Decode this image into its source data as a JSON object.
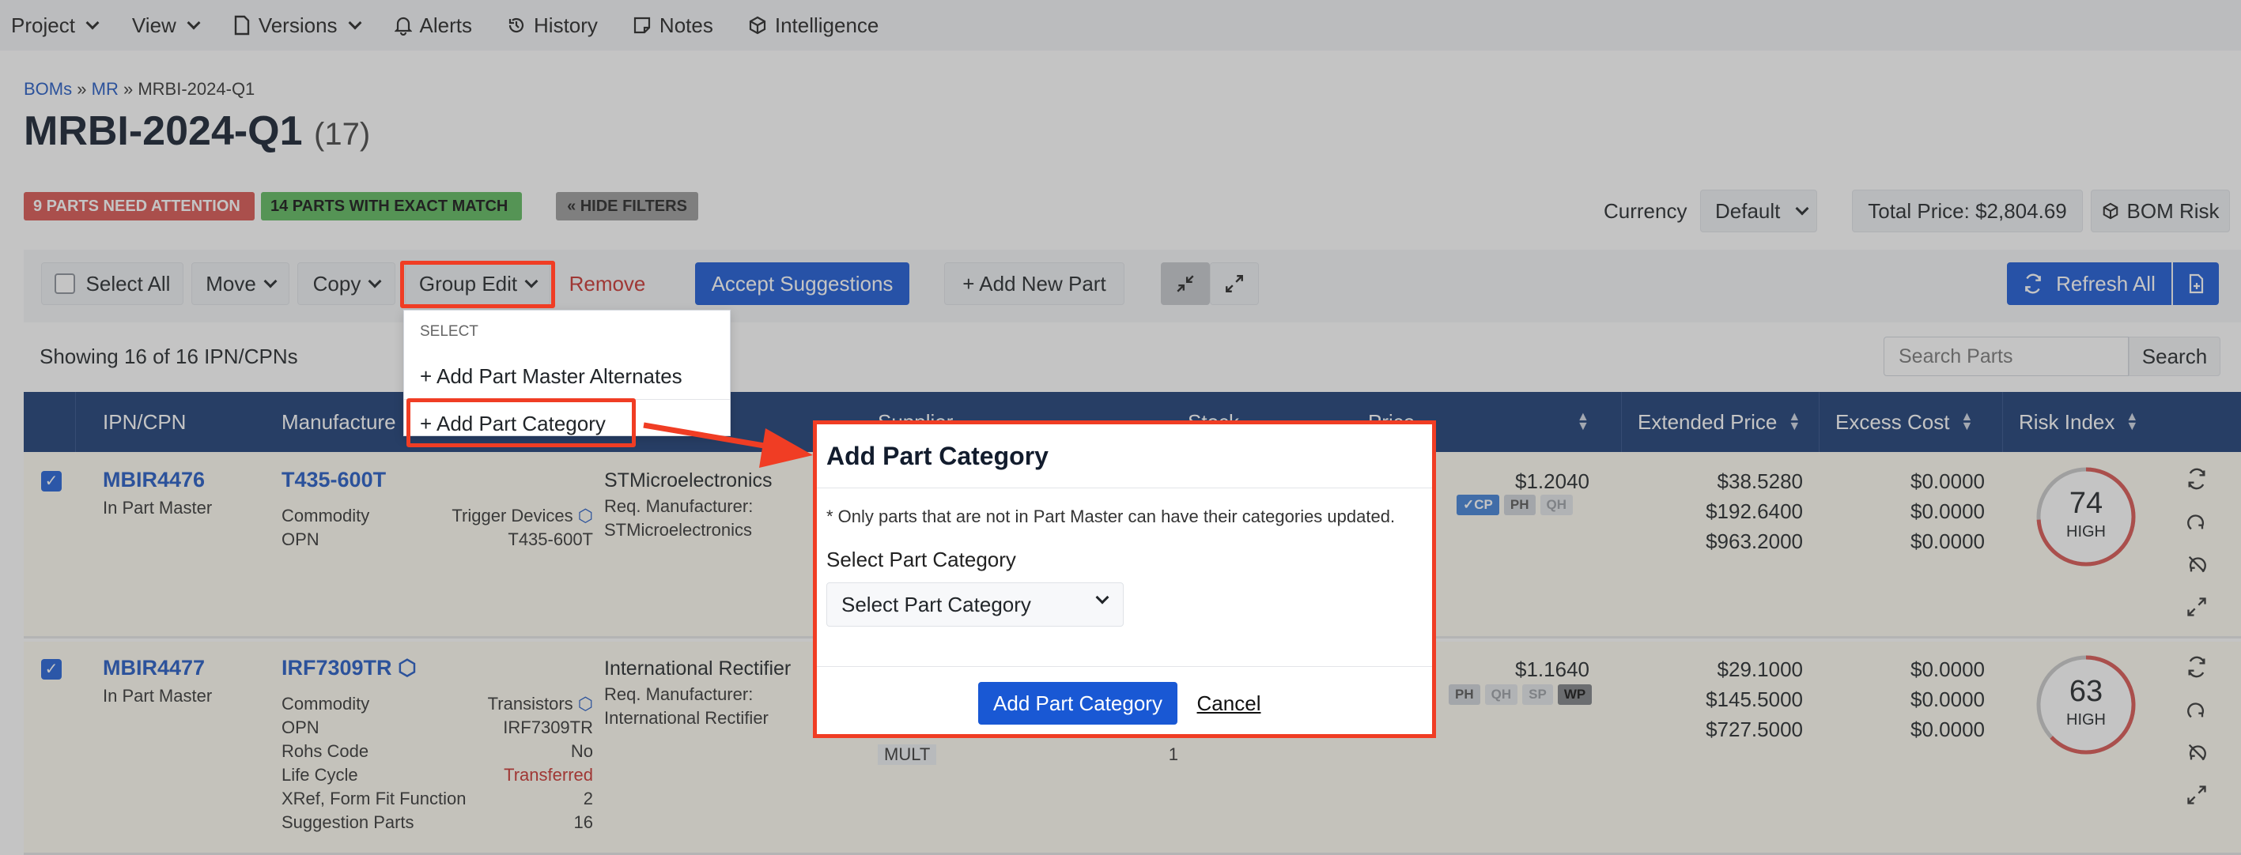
{
  "nav": {
    "items": [
      {
        "label": "Project",
        "icon": "",
        "chevron": true
      },
      {
        "label": "View",
        "icon": "",
        "chevron": true
      },
      {
        "label": "Versions",
        "icon": "document-icon",
        "chevron": true
      },
      {
        "label": "Alerts",
        "icon": "bell-icon",
        "chevron": false
      },
      {
        "label": "History",
        "icon": "history-icon",
        "chevron": false
      },
      {
        "label": "Notes",
        "icon": "note-icon",
        "chevron": false
      },
      {
        "label": "Intelligence",
        "icon": "cube-icon",
        "chevron": false
      }
    ]
  },
  "breadcrumb": {
    "boms": "BOMs",
    "sep": "»",
    "mr": "MR",
    "current": "MRBI-2024-Q1"
  },
  "page": {
    "title": "MRBI-2024-Q1",
    "count": "(17)"
  },
  "badges": {
    "attention": "9 PARTS NEED ATTENTION",
    "exact": "14 PARTS WITH EXACT MATCH",
    "hide_filters": "« HIDE FILTERS"
  },
  "header_right": {
    "currency_label": "Currency",
    "currency_value": "Default",
    "total_price": "Total Price: $2,804.69",
    "bom_risk": "BOM Risk"
  },
  "toolbar": {
    "select_all": "Select All",
    "move": "Move",
    "copy": "Copy",
    "group_edit": "Group Edit",
    "remove": "Remove",
    "accept": "Accept Suggestions",
    "add_part": "+ Add New Part",
    "refresh": "Refresh All"
  },
  "showing": "Showing 16 of 16 IPN/CPNs",
  "search": {
    "placeholder": "Search Parts",
    "button": "Search"
  },
  "dropdown": {
    "header": "SELECT",
    "alternates": "+ Add Part Master Alternates",
    "category": "+ Add Part Category"
  },
  "columns": {
    "ipn": "IPN/CPN",
    "manufacturer": "Manufacture",
    "supplier": "Supplier",
    "stock": "Stock",
    "price": "Price",
    "extended": "Extended Price",
    "excess": "Excess Cost",
    "risk": "Risk Index"
  },
  "rows": [
    {
      "ipn": "MBIR4476",
      "ipn_sub": "In Part Master",
      "mpn": "T435-600T",
      "attrs": [
        {
          "k": "Commodity",
          "v": "Trigger Devices"
        },
        {
          "k": "OPN",
          "v": "T435-600T"
        }
      ],
      "mfr": "STMicroelectronics",
      "req_label": "Req. Manufacturer:",
      "req_value": "STMicroelectronics",
      "price": "$1.2040",
      "tags": [
        "✓CP",
        "PH",
        "QH"
      ],
      "extended": [
        "$38.5280",
        "$192.6400",
        "$963.2000"
      ],
      "excess": [
        "$0.0000",
        "$0.0000",
        "$0.0000"
      ],
      "risk_value": "74",
      "risk_level": "HIGH",
      "risk_fraction": 0.74
    },
    {
      "ipn": "MBIR4477",
      "ipn_sub": "In Part Master",
      "mpn": "IRF7309TR",
      "attrs": [
        {
          "k": "Commodity",
          "v": "Transistors"
        },
        {
          "k": "OPN",
          "v": "IRF7309TR"
        },
        {
          "k": "Rohs Code",
          "v": "No"
        },
        {
          "k": "Life Cycle",
          "v": "Transferred"
        },
        {
          "k": "XRef, Form Fit Function",
          "v": "2"
        },
        {
          "k": "Suggestion Parts",
          "v": "16"
        }
      ],
      "mfr": "International Rectifier",
      "req_label": "Req. Manufacturer:",
      "req_value": "International Rectifier",
      "mult_label": "MULT",
      "mult_value": "1",
      "price": "$1.1640",
      "tags": [
        "PH",
        "QH",
        "SP",
        "WP"
      ],
      "extended": [
        "$29.1000",
        "$145.5000",
        "$727.5000"
      ],
      "excess": [
        "$0.0000",
        "$0.0000",
        "$0.0000"
      ],
      "risk_value": "63",
      "risk_level": "HIGH",
      "risk_fraction": 0.63
    }
  ],
  "modal": {
    "title": "Add Part Category",
    "note": "* Only parts that are not in Part Master can have their categories updated.",
    "label": "Select Part Category",
    "select_value": "Select Part Category",
    "submit": "Add Part Category",
    "cancel": "Cancel"
  },
  "colors": {
    "primary": "#1958d4",
    "header_bg": "#193a74",
    "highlight": "#f03d24",
    "danger": "#d9534f",
    "success": "#5cb85c",
    "risk_high": "#d9534f"
  }
}
